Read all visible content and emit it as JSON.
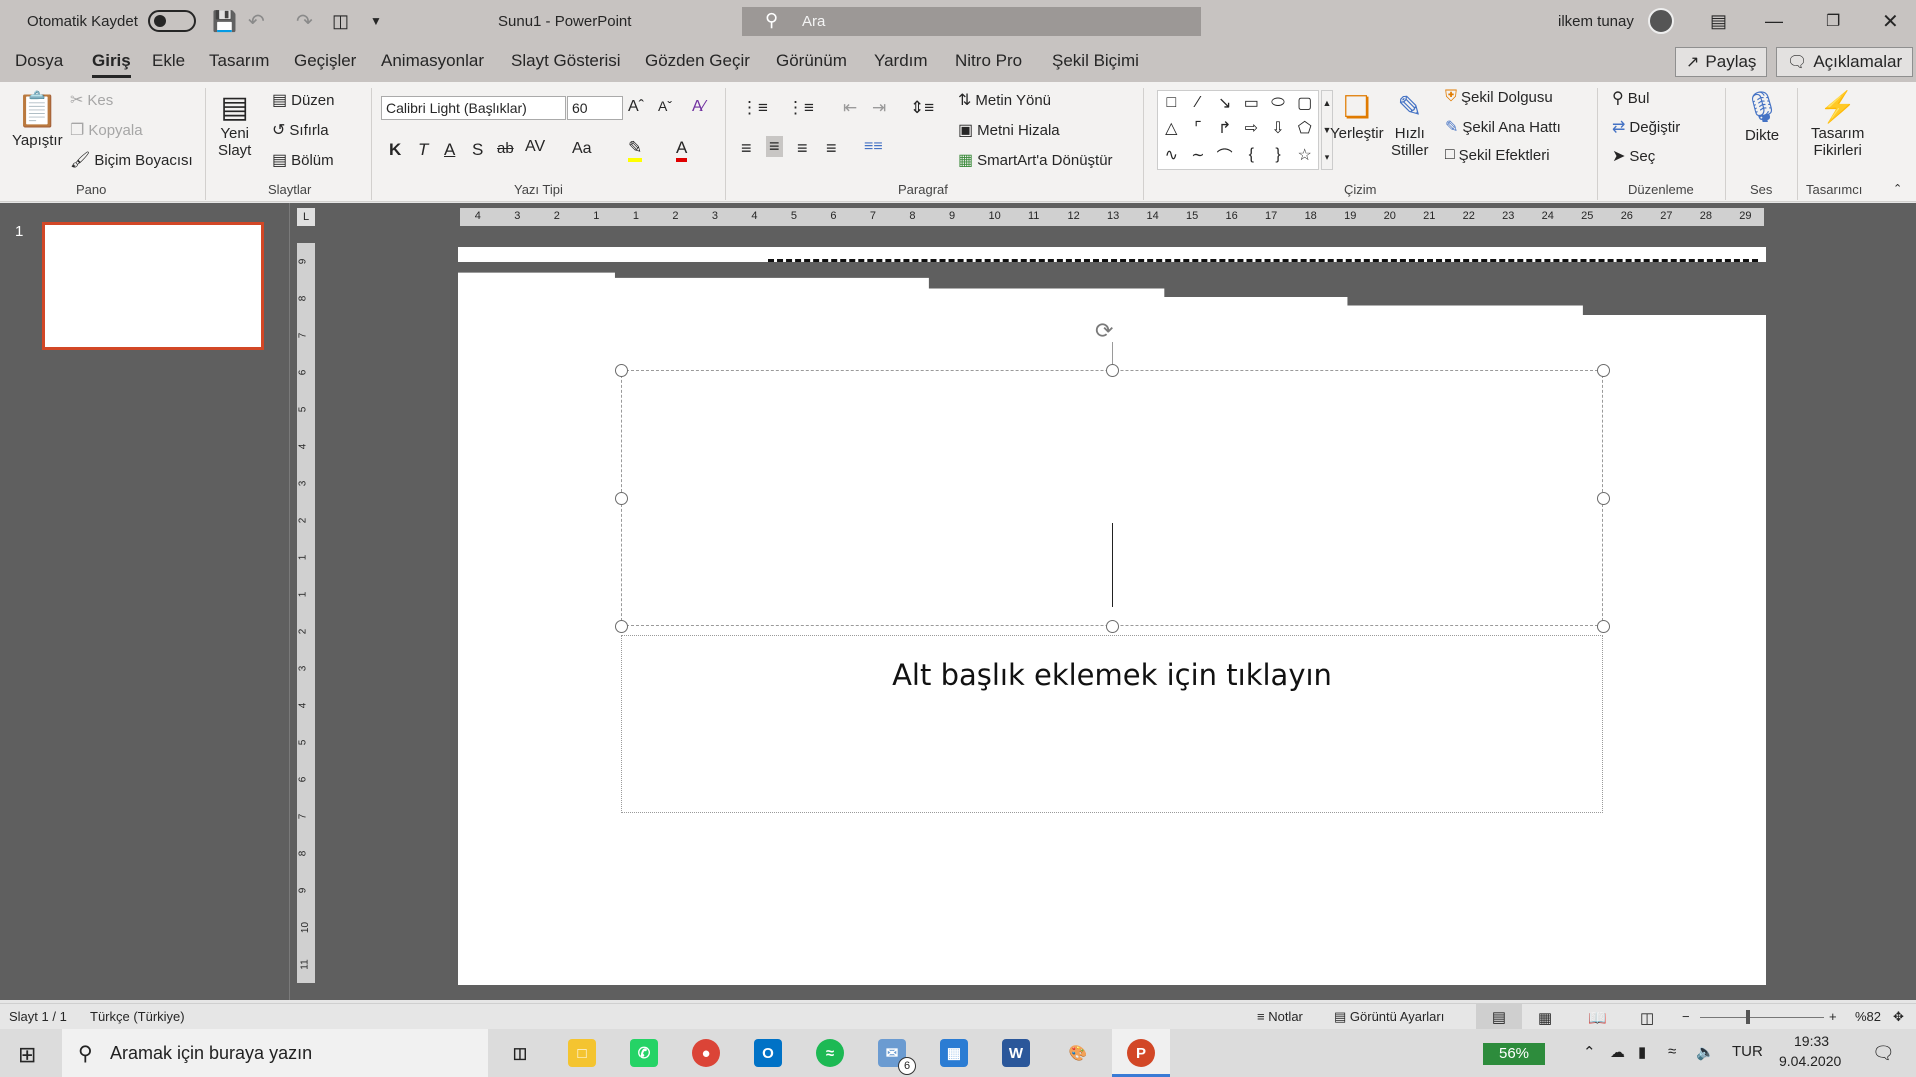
{
  "titlebar": {
    "autosave_label": "Otomatik Kaydet",
    "doc_title": "Sunu1  -  PowerPoint",
    "search_placeholder": "Ara",
    "user_name": "ilkem tunay"
  },
  "menu": {
    "items": [
      "Dosya",
      "Giriş",
      "Ekle",
      "Tasarım",
      "Geçişler",
      "Animasyonlar",
      "Slayt Gösterisi",
      "Gözden Geçir",
      "Görünüm",
      "Yardım",
      "Nitro Pro",
      "Şekil Biçimi"
    ],
    "share": "Paylaş",
    "comments": "Açıklamalar"
  },
  "ribbon": {
    "pano": {
      "paste": "Yapıştır",
      "cut": "Kes",
      "copy": "Kopyala",
      "format_painter": "Biçim Boyacısı",
      "group": "Pano"
    },
    "slaytlar": {
      "new_slide_1": "Yeni",
      "new_slide_2": "Slayt",
      "layout": "Düzen",
      "reset": "Sıfırla",
      "section": "Bölüm",
      "group": "Slaytlar"
    },
    "yazi": {
      "font_name": "Calibri Light (Başlıklar)",
      "font_size": "60",
      "bold": "K",
      "italic": "T",
      "underline": "A",
      "shadow": "S",
      "strike": "ab",
      "spacing": "AV",
      "case": "Aa",
      "group": "Yazı Tipi"
    },
    "paragraf": {
      "text_dir": "Metin Yönü",
      "align_text": "Metni Hizala",
      "smartart": "SmartArt'a Dönüştür",
      "group": "Paragraf"
    },
    "cizim": {
      "arrange": "Yerleştir",
      "quick_1": "Hızlı",
      "quick_2": "Stiller",
      "fill": "Şekil Dolgusu",
      "outline": "Şekil Ana Hattı",
      "effects": "Şekil Efektleri",
      "group": "Çizim"
    },
    "duzenleme": {
      "find": "Bul",
      "replace": "Değiştir",
      "select": "Seç",
      "group": "Düzenleme"
    },
    "ses": {
      "dictate": "Dikte",
      "group": "Ses"
    },
    "tasarimci": {
      "ideas_1": "Tasarım",
      "ideas_2": "Fikirleri",
      "group": "Tasarımcı"
    }
  },
  "thumbnails": {
    "slide_number": "1"
  },
  "ruler": {
    "h_ticks": [
      "4",
      "3",
      "2",
      "1",
      "1",
      "2",
      "3",
      "4",
      "5",
      "6",
      "7",
      "8",
      "9",
      "10",
      "11",
      "12",
      "13",
      "14",
      "15",
      "16",
      "17",
      "18",
      "19",
      "20",
      "21",
      "22",
      "23",
      "24",
      "25",
      "26",
      "27",
      "28",
      "29"
    ],
    "v_ticks": [
      "9",
      "8",
      "7",
      "6",
      "5",
      "4",
      "3",
      "2",
      "1",
      "1",
      "2",
      "3",
      "4",
      "5",
      "6",
      "7",
      "8",
      "9",
      "10",
      "11"
    ],
    "corner": "L"
  },
  "slide": {
    "subtitle_placeholder": "Alt başlık eklemek için tıklayın"
  },
  "status": {
    "slide_info": "Slayt 1 / 1",
    "language": "Türkçe (Türkiye)",
    "notes": "Notlar",
    "display_settings": "Görüntü Ayarları",
    "zoom": "%82"
  },
  "taskbar": {
    "search_placeholder": "Aramak için buraya yazın",
    "mail_badge": "6",
    "battery": "56%",
    "lang": "TUR",
    "time": "19:33",
    "date": "9.04.2020"
  },
  "colors": {
    "accent": "#d24726",
    "titlebar": "#c7c3c1"
  }
}
